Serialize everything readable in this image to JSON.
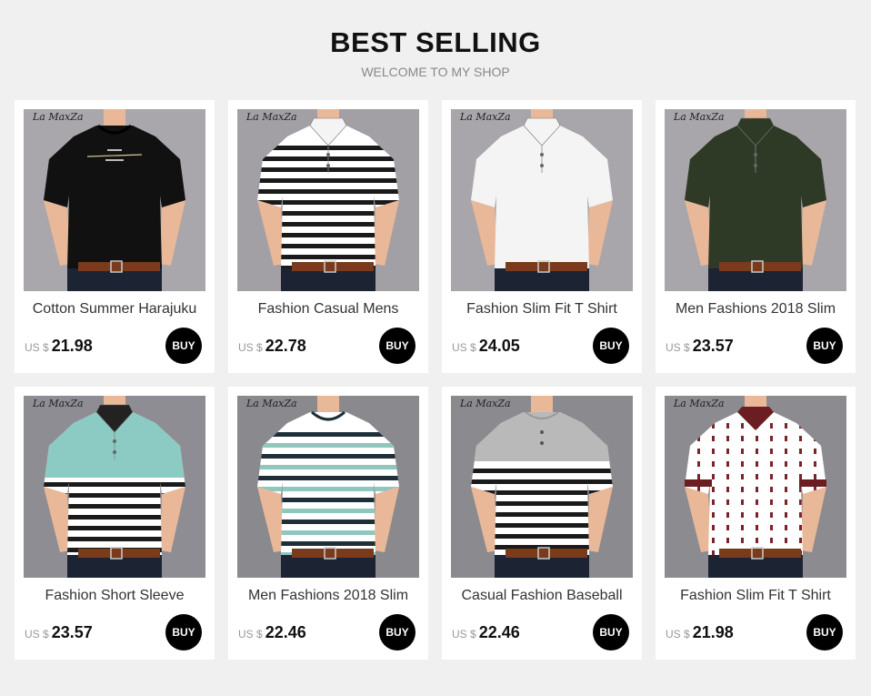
{
  "header": {
    "title": "BEST SELLING",
    "subtitle": "WELCOME TO MY SHOP"
  },
  "products": [
    {
      "name": "Cotton Summer Harajuku",
      "currency": "US $",
      "price": "21.98",
      "buy_label": "BUY",
      "brand": "La MaxZa",
      "shirt_color": "#111111",
      "bg_color": "#a9a7ab",
      "style": "tee-print"
    },
    {
      "name": "Fashion Casual Mens",
      "currency": "US $",
      "price": "22.78",
      "buy_label": "BUY",
      "brand": "La MaxZa",
      "shirt_color": "#ffffff",
      "bg_color": "#a3a0a5",
      "style": "polo-stripes-bw"
    },
    {
      "name": "Fashion Slim Fit T Shirt",
      "currency": "US $",
      "price": "24.05",
      "buy_label": "BUY",
      "brand": "La MaxZa",
      "shirt_color": "#f4f4f4",
      "bg_color": "#a8a6aa",
      "style": "polo-plain"
    },
    {
      "name": "Men Fashions 2018 Slim",
      "currency": "US $",
      "price": "23.57",
      "buy_label": "BUY",
      "brand": "La MaxZa",
      "shirt_color": "#2f3a26",
      "bg_color": "#a8a6aa",
      "style": "polo-plain"
    },
    {
      "name": "Fashion Short Sleeve",
      "currency": "US $",
      "price": "23.57",
      "buy_label": "BUY",
      "brand": "La MaxZa",
      "shirt_color": "#ffffff",
      "bg_color": "#8e8d93",
      "style": "polo-teal-stripes"
    },
    {
      "name": "Men Fashions 2018 Slim",
      "currency": "US $",
      "price": "22.46",
      "buy_label": "BUY",
      "brand": "La MaxZa",
      "shirt_color": "#ffffff",
      "bg_color": "#8a898e",
      "style": "tee-teal-stripes"
    },
    {
      "name": "Casual Fashion Baseball",
      "currency": "US $",
      "price": "22.46",
      "buy_label": "BUY",
      "brand": "La MaxZa",
      "shirt_color": "#ffffff",
      "bg_color": "#8b8a8f",
      "style": "henley-grey-stripes"
    },
    {
      "name": "Fashion Slim Fit T Shirt",
      "currency": "US $",
      "price": "21.98",
      "buy_label": "BUY",
      "brand": "La MaxZa",
      "shirt_color": "#ffffff",
      "bg_color": "#8c8b90",
      "style": "polo-print"
    }
  ],
  "colors": {
    "page_bg": "#f0f0f0",
    "card_bg": "#ffffff",
    "button_bg": "#000000",
    "title": "#111111",
    "subtitle": "#888888"
  }
}
